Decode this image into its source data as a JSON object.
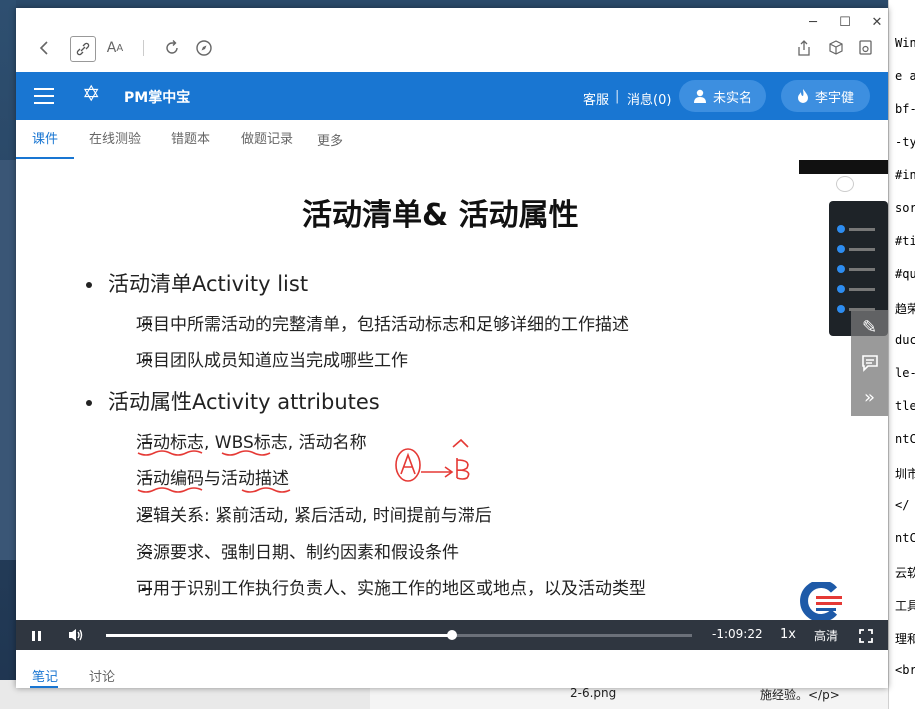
{
  "window": {
    "controls": {
      "minimize": "─",
      "maximize": "☐",
      "close": "✕"
    }
  },
  "app": {
    "brand": "PM掌中宝",
    "service_link": "客服",
    "separator": "|",
    "messages_link": "消息(0)",
    "unverified_label": "未实名",
    "user_name": "李宇健"
  },
  "tabs": [
    {
      "label": "课件",
      "active": true
    },
    {
      "label": "在线测验"
    },
    {
      "label": "错题本"
    },
    {
      "label": "做题记录"
    },
    {
      "label": "更多"
    }
  ],
  "slide": {
    "title": "活动清单& 活动属性",
    "bullets": [
      {
        "text": "活动清单Activity list",
        "subs": [
          "项目中所需活动的完整清单，包括活动标志和足够详细的工作描述",
          "项目团队成员知道应当完成哪些工作"
        ]
      },
      {
        "text": "活动属性Activity attributes",
        "subs": [
          "活动标志, WBS标志, 活动名称",
          "活动编码与活动描述",
          "逻辑关系: 紧前活动, 紧后活动, 时间提前与滞后",
          "资源要求、强制日期、制约因素和假设条件",
          "可用于识别工作执行负责人、实施工作的地区或地点，以及活动类型"
        ]
      }
    ],
    "annotation": "A→B"
  },
  "player": {
    "remaining_time": "-1:09:22",
    "speed": "1x",
    "quality": "高清",
    "progress": 0.59
  },
  "bottom_tabs": [
    {
      "label": "笔记",
      "active": true
    },
    {
      "label": "讨论"
    }
  ],
  "background": {
    "file_name": "2-6.png",
    "code_lines": [
      "Win",
      "e all",
      "bf-",
      "-ty",
      "#in",
      "sor",
      "#ti",
      "#qu",
      "趋荣",
      "duc",
      "le-",
      "tle",
      "ntC",
      "圳市",
      "</",
      "ntC",
      "云软",
      "工具",
      "理和",
      "<br"
    ],
    "code_tail": "施经验。</p>"
  },
  "colors": {
    "accent": "#1976d2",
    "player_bg": "#2f3640",
    "annotation": "#e53935"
  }
}
